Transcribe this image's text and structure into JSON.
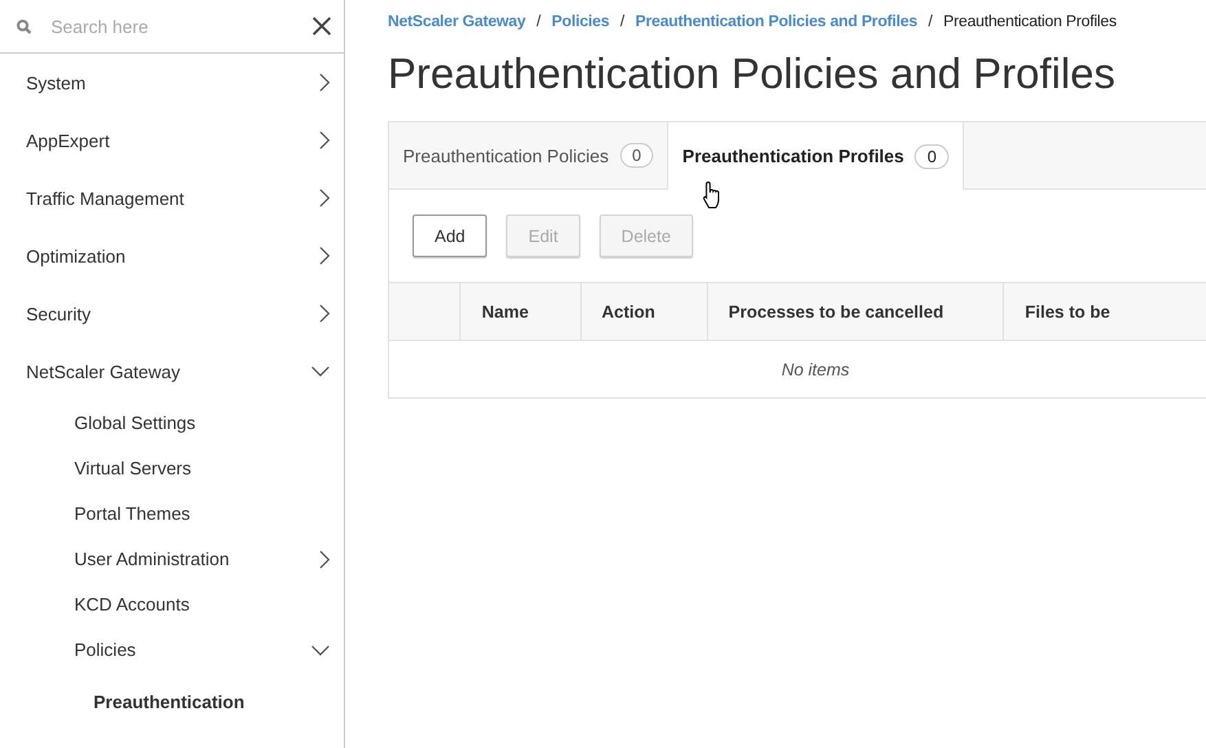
{
  "sidebar": {
    "search": {
      "placeholder": "Search here"
    },
    "items": [
      {
        "label": "System",
        "kind": "group",
        "expanded": false,
        "selected": false
      },
      {
        "label": "AppExpert",
        "kind": "group",
        "expanded": false,
        "selected": false
      },
      {
        "label": "Traffic Management",
        "kind": "group",
        "expanded": false,
        "selected": false
      },
      {
        "label": "Optimization",
        "kind": "group",
        "expanded": false,
        "selected": false
      },
      {
        "label": "Security",
        "kind": "group",
        "expanded": false,
        "selected": false
      },
      {
        "label": "NetScaler Gateway",
        "kind": "group",
        "expanded": true,
        "selected": false,
        "children": [
          {
            "label": "Global Settings",
            "selected": false
          },
          {
            "label": "Virtual Servers",
            "selected": false
          },
          {
            "label": "Portal Themes",
            "selected": false
          },
          {
            "label": "User Administration",
            "kind": "group",
            "expanded": false,
            "selected": false
          },
          {
            "label": "KCD Accounts",
            "selected": false
          },
          {
            "label": "Policies",
            "kind": "group",
            "expanded": true,
            "selected": false,
            "children": [
              {
                "label": "Preauthentication",
                "selected": true
              }
            ]
          }
        ]
      }
    ]
  },
  "breadcrumb": {
    "links": [
      "NetScaler Gateway",
      "Policies",
      "Preauthentication Policies and Profiles"
    ],
    "separator": "/",
    "current": "Preauthentication Profiles"
  },
  "page_title": "Preauthentication Policies and Profiles",
  "tabs": [
    {
      "label": "Preauthentication Policies",
      "count": "0",
      "selected": false
    },
    {
      "label": "Preauthentication Profiles",
      "count": "0",
      "selected": true
    }
  ],
  "buttons": [
    {
      "label": "Add",
      "disabled": false
    },
    {
      "label": "Edit",
      "disabled": true
    },
    {
      "label": "Delete",
      "disabled": true
    }
  ],
  "table": {
    "columns": [
      "Name",
      "Action",
      "Processes to be cancelled",
      "Files to be"
    ],
    "empty_message": "No items"
  }
}
